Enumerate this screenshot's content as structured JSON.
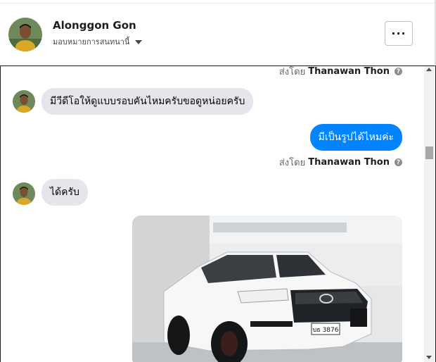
{
  "header": {
    "name": "Alonggon Gon",
    "subtitle": "มอบหมายการสนทนานี้",
    "more_label": "···",
    "avatar": "person-avatar"
  },
  "messages": [
    {
      "type": "meta",
      "prefix": "ส่งโดย",
      "sender": "Thanawan Thon"
    },
    {
      "type": "incoming",
      "text": "มีวีดีโอให้ดูแบบรอบคันไหมครับขอดูหน่อยครับ"
    },
    {
      "type": "outgoing",
      "text": "มีเป็นรูปได้ไหมค่ะ"
    },
    {
      "type": "meta",
      "prefix": "ส่งโดย",
      "sender": "Thanawan Thon"
    },
    {
      "type": "incoming",
      "text": "ได้ครับ"
    },
    {
      "type": "incoming-image",
      "plate": "บธ 3876"
    }
  ],
  "colors": {
    "outgoing_bubble": "#0084ff",
    "incoming_bubble": "#e4e6eb",
    "meta_text": "#65676b"
  }
}
